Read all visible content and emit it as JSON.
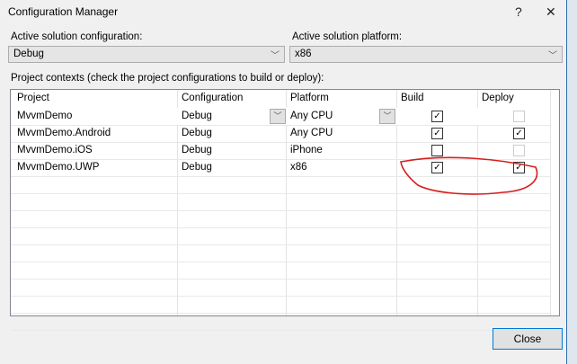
{
  "window": {
    "title": "Configuration Manager",
    "help": "?",
    "close": "✕"
  },
  "active_config": {
    "label": "Active solution configuration:",
    "value": "Debug"
  },
  "active_platform": {
    "label": "Active solution platform:",
    "value": "x86"
  },
  "contexts_label": "Project contexts (check the project configurations to build or deploy):",
  "columns": [
    "Project",
    "Configuration",
    "Platform",
    "Build",
    "Deploy"
  ],
  "rows": [
    {
      "project": "MvvmDemo",
      "configuration": "Debug",
      "platform": "Any CPU",
      "build": true,
      "deploy": false,
      "deploy_enabled": false
    },
    {
      "project": "MvvmDemo.Android",
      "configuration": "Debug",
      "platform": "Any CPU",
      "build": true,
      "deploy": true,
      "deploy_enabled": true
    },
    {
      "project": "MvvmDemo.iOS",
      "configuration": "Debug",
      "platform": "iPhone",
      "build": false,
      "deploy": false,
      "deploy_enabled": false
    },
    {
      "project": "MvvmDemo.UWP",
      "configuration": "Debug",
      "platform": "x86",
      "build": true,
      "deploy": true,
      "deploy_enabled": true
    }
  ],
  "close_button": "Close",
  "annotation_color": "#d42020"
}
